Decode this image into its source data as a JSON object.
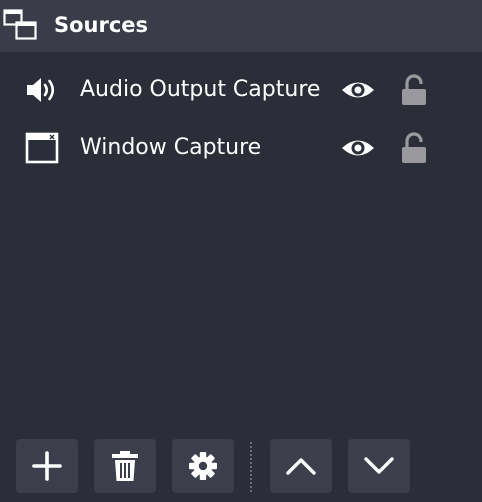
{
  "dock": {
    "title": "Sources",
    "title_icon": "sources-dock-icon"
  },
  "sources": [
    {
      "label": "Audio Output Capture",
      "type_icon": "speaker-icon",
      "visible": true,
      "locked": false
    },
    {
      "label": "Window Capture",
      "type_icon": "window-icon",
      "visible": true,
      "locked": false
    }
  ],
  "toolbar": {
    "buttons": [
      {
        "name": "add-source-button",
        "icon": "plus-icon"
      },
      {
        "name": "remove-source-button",
        "icon": "trash-icon"
      },
      {
        "name": "source-properties-button",
        "icon": "gear-icon"
      },
      {
        "name": "move-source-up-button",
        "icon": "chevron-up-icon"
      },
      {
        "name": "move-source-down-button",
        "icon": "chevron-down-icon"
      }
    ]
  },
  "colors": {
    "background": "#2b2e38",
    "header": "#3a3d49",
    "button": "#3c3f4b",
    "text": "#ffffff",
    "lock": "#9a9a9e"
  }
}
